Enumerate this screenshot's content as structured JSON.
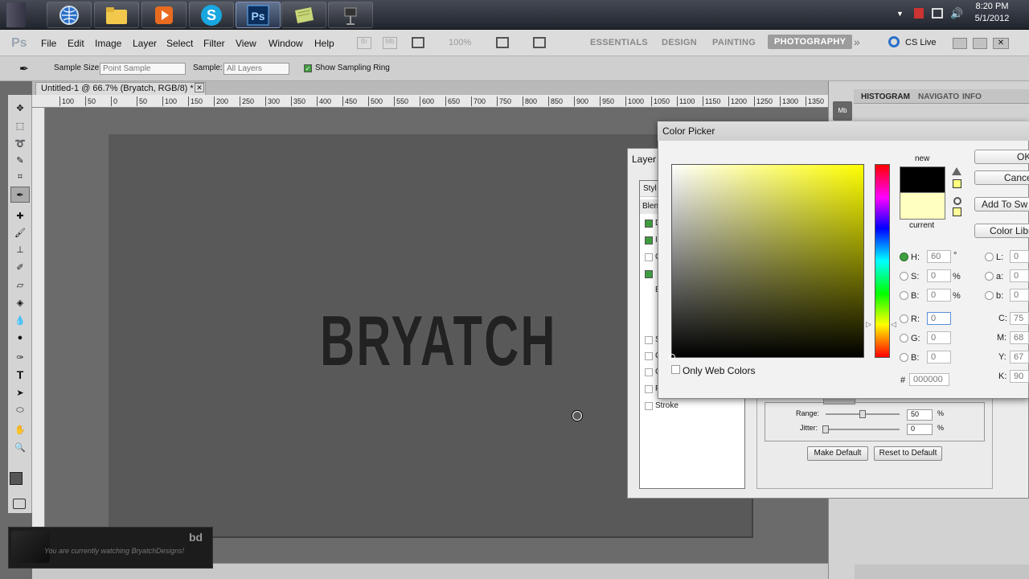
{
  "taskbar": {
    "apps": [
      {
        "name": "chrome-like-browser",
        "icon": "globe-icon"
      },
      {
        "name": "file-explorer",
        "icon": "folder-icon"
      },
      {
        "name": "media-player",
        "icon": "play-icon"
      },
      {
        "name": "skype",
        "icon": "skype-icon",
        "label": "S"
      },
      {
        "name": "photoshop",
        "icon": "photoshop-icon",
        "label": "Ps"
      },
      {
        "name": "notes",
        "icon": "notes-icon"
      },
      {
        "name": "camera",
        "icon": "camera-icon"
      }
    ],
    "time": "8:20 PM",
    "date": "5/1/2012"
  },
  "menubar": {
    "logo": "Ps",
    "menus": [
      "File",
      "Edit",
      "Image",
      "Layer",
      "Select",
      "Filter",
      "View",
      "Window",
      "Help"
    ],
    "zoom": "100%",
    "workspaces": [
      "ESSENTIALS",
      "DESIGN",
      "PAINTING",
      "PHOTOGRAPHY"
    ],
    "active_workspace": "PHOTOGRAPHY",
    "cs_live": "CS Live"
  },
  "options": {
    "sample_size_label": "Sample Size:",
    "sample_size_value": "Point Sample",
    "sample_label": "Sample:",
    "sample_value": "All Layers",
    "show_ring_label": "Show Sampling Ring"
  },
  "document": {
    "tab_title": "Untitled-1 @ 66.7% (Bryatch, RGB/8) *",
    "ruler_marks": [
      "100",
      "50",
      "0",
      "50",
      "100",
      "150",
      "200",
      "250",
      "300",
      "350",
      "400",
      "450",
      "500",
      "550",
      "600",
      "650",
      "700",
      "750",
      "800",
      "850",
      "900",
      "950",
      "1000",
      "1050",
      "1100",
      "1150",
      "1200",
      "1250",
      "1300",
      "1350"
    ],
    "canvas_text": "BRYATCH"
  },
  "panels": {
    "tabs": [
      "HISTOGRAM",
      "NAVIGATO",
      "INFO"
    ]
  },
  "layer_style": {
    "title": "Layer S",
    "styles_header": "Styl",
    "blend_header": "Blen",
    "items": [
      {
        "label": "D",
        "checked": true
      },
      {
        "label": "I",
        "checked": true
      },
      {
        "label": "O",
        "checked": false
      },
      {
        "label": "",
        "checked": true
      },
      {
        "label": "E",
        "checked": false
      },
      {
        "label": "S",
        "checked": false
      },
      {
        "label": "C",
        "checked": false
      },
      {
        "label": "C",
        "checked": false
      },
      {
        "label": "P",
        "checked": false
      },
      {
        "label": "Stroke",
        "checked": false
      }
    ],
    "range_label": "Range:",
    "range_value": "50",
    "jitter_label": "Jitter:",
    "jitter_value": "0",
    "percent": "%",
    "make_default": "Make Default",
    "reset_default": "Reset to Default"
  },
  "color_picker": {
    "title": "Color Picker",
    "new_label": "new",
    "current_label": "current",
    "ok": "OK",
    "cancel": "Cance",
    "add_swatches": "Add To Sw",
    "color_libraries": "Color Libr",
    "only_web": "Only Web Colors",
    "h_label": "H:",
    "h_value": "60",
    "h_unit": "°",
    "s_label": "S:",
    "s_value": "0",
    "s_unit": "%",
    "b_label": "B:",
    "b_value": "0",
    "b_unit": "%",
    "r_label": "R:",
    "r_value": "0",
    "g_label": "G:",
    "g_value": "0",
    "bb_label": "B:",
    "bb_value": "0",
    "l_label": "L:",
    "l_value": "0",
    "a_label": "a:",
    "a_value": "0",
    "lb_label": "b:",
    "lb_value": "0",
    "c_label": "C:",
    "c_value": "75",
    "m_label": "M:",
    "m_value": "68",
    "y_label": "Y:",
    "y_value": "67",
    "k_label": "K:",
    "k_value": "90",
    "hash": "#",
    "hex_value": "000000",
    "new_color": "#000000",
    "current_color": "#ffffc0"
  },
  "watermark": {
    "text": "You are currently watching BryatchDesigns!",
    "logo": "bd"
  }
}
